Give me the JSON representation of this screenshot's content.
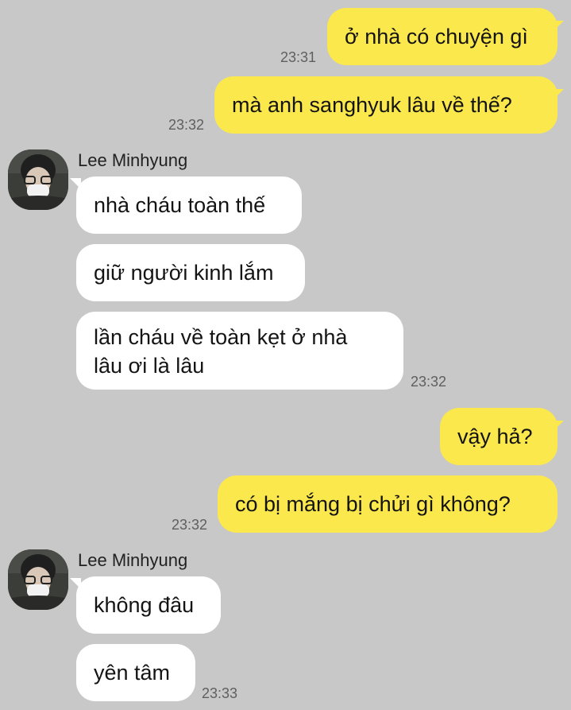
{
  "contact": {
    "name": "Lee Minhyung"
  },
  "messages": [
    {
      "sender": "me",
      "text": "ở nhà có chuyện gì"
    },
    {
      "sender": "me",
      "text": "mà anh sanghyuk lâu về thế?"
    },
    {
      "sender": "them",
      "text": "nhà cháu toàn thế"
    },
    {
      "sender": "them",
      "text": "giữ người kinh lắm"
    },
    {
      "sender": "them",
      "lines": [
        "lần cháu về toàn kẹt ở nhà",
        "lâu ơi là lâu"
      ]
    },
    {
      "sender": "me",
      "text": "vậy hả?"
    },
    {
      "sender": "me",
      "text": "có bị mắng bị chửi gì không?"
    },
    {
      "sender": "them",
      "text": "không đâu"
    },
    {
      "sender": "them",
      "text": "yên tâm"
    }
  ],
  "timestamps": [
    "23:31",
    "23:32",
    "23:32",
    "23:32",
    "23:33"
  ],
  "colors": {
    "background": "#c8c8c8",
    "outgoing_bubble": "#fbe84c",
    "incoming_bubble": "#ffffff"
  },
  "icons": {
    "avatar": "profile-photo-person-with-mask-and-glasses"
  }
}
